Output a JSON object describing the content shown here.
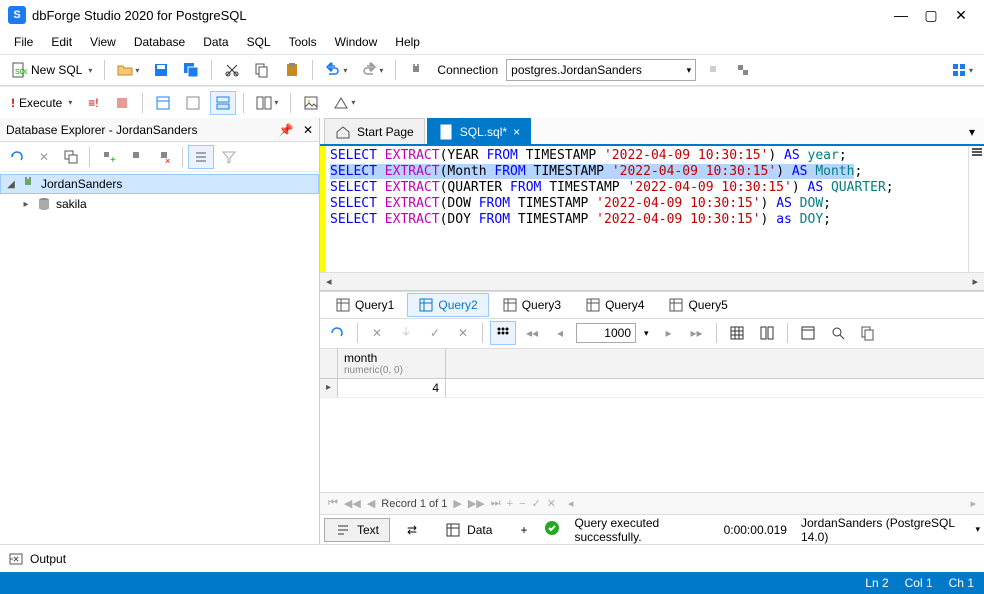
{
  "window": {
    "title": "dbForge Studio 2020 for PostgreSQL",
    "logo_letter": "S"
  },
  "menu": [
    "File",
    "Edit",
    "View",
    "Database",
    "Data",
    "SQL",
    "Tools",
    "Window",
    "Help"
  ],
  "toolbar1": {
    "new_sql": "New SQL",
    "connection_label": "Connection",
    "connection_value": "postgres.JordanSanders"
  },
  "toolbar2": {
    "execute": "Execute"
  },
  "explorer": {
    "title": "Database Explorer - JordanSanders",
    "root": "JordanSanders",
    "db": "sakila"
  },
  "tabs": {
    "start": "Start Page",
    "sql": "SQL.sql*"
  },
  "editor": {
    "lines": [
      {
        "sel": false,
        "parts": [
          [
            "kw",
            "SELECT "
          ],
          [
            "fn",
            "EXTRACT"
          ],
          [
            "",
            ")"
          ],
          [
            "",
            "(YEAR "
          ],
          [
            "kw",
            "FROM"
          ],
          [
            "",
            ""
          ],
          [
            "",
            ""
          ],
          [
            "",
            ""
          ]
        ],
        "raw": "SELECT EXTRACT(YEAR FROM TIMESTAMP '2022-04-09 10:30:15') AS year;"
      },
      {
        "sel": true,
        "raw": "SELECT EXTRACT(Month FROM TIMESTAMP '2022-04-09 10:30:15') AS Month;"
      },
      {
        "sel": false,
        "raw": "SELECT EXTRACT(QUARTER FROM TIMESTAMP '2022-04-09 10:30:15') AS QUARTER;"
      },
      {
        "sel": false,
        "raw": "SELECT EXTRACT(DOW FROM TIMESTAMP '2022-04-09 10:30:15') AS DOW;"
      },
      {
        "sel": false,
        "raw": "SELECT EXTRACT(DOY FROM TIMESTAMP '2022-04-09 10:30:15') as DOY;"
      }
    ],
    "l1": {
      "select": "SELECT ",
      "extract": "EXTRACT",
      "open": "(",
      "part": "YEAR ",
      "from": "FROM ",
      "ts": "TIMESTAMP ",
      "str": "'2022-04-09 10:30:15'",
      "close": ") ",
      "as": "AS ",
      "alias": "year",
      "semi": ";"
    },
    "l2": {
      "select": "SELECT ",
      "extract": "EXTRACT",
      "open": "(",
      "part": "Month ",
      "from": "FROM ",
      "ts": "TIMESTAMP ",
      "str": "'2022-04-09 10:30:15'",
      "close": ") ",
      "as": "AS ",
      "alias": "Month",
      "semi": ";"
    },
    "l3": {
      "select": "SELECT ",
      "extract": "EXTRACT",
      "open": "(",
      "part": "QUARTER ",
      "from": "FROM ",
      "ts": "TIMESTAMP ",
      "str": "'2022-04-09 10:30:15'",
      "close": ") ",
      "as": "AS ",
      "alias": "QUARTER",
      "semi": ";"
    },
    "l4": {
      "select": "SELECT ",
      "extract": "EXTRACT",
      "open": "(",
      "part": "DOW ",
      "from": "FROM ",
      "ts": "TIMESTAMP ",
      "str": "'2022-04-09 10:30:15'",
      "close": ") ",
      "as": "AS ",
      "alias": "DOW",
      "semi": ";"
    },
    "l5": {
      "select": "SELECT ",
      "extract": "EXTRACT",
      "open": "(",
      "part": "DOY ",
      "from": "FROM ",
      "ts": "TIMESTAMP ",
      "str": "'2022-04-09 10:30:15'",
      "close": ") ",
      "as": "as ",
      "alias": "DOY",
      "semi": ";"
    }
  },
  "query_tabs": [
    "Query1",
    "Query2",
    "Query3",
    "Query4",
    "Query5"
  ],
  "query_active_index": 1,
  "grid_toolbar": {
    "page_size": "1000"
  },
  "grid": {
    "col_name": "month",
    "col_type": "numeric(0, 0)",
    "value": "4"
  },
  "record_bar": {
    "text": "Record 1 of 1"
  },
  "bottom": {
    "text_tab": "Text",
    "data_tab": "Data",
    "status_msg": "Query executed successfully.",
    "elapsed": "0:00:00.019",
    "conn": "JordanSanders (PostgreSQL 14.0)"
  },
  "output": {
    "label": "Output"
  },
  "statusbar": {
    "ln": "Ln 2",
    "col": "Col 1",
    "ch": "Ch 1"
  }
}
